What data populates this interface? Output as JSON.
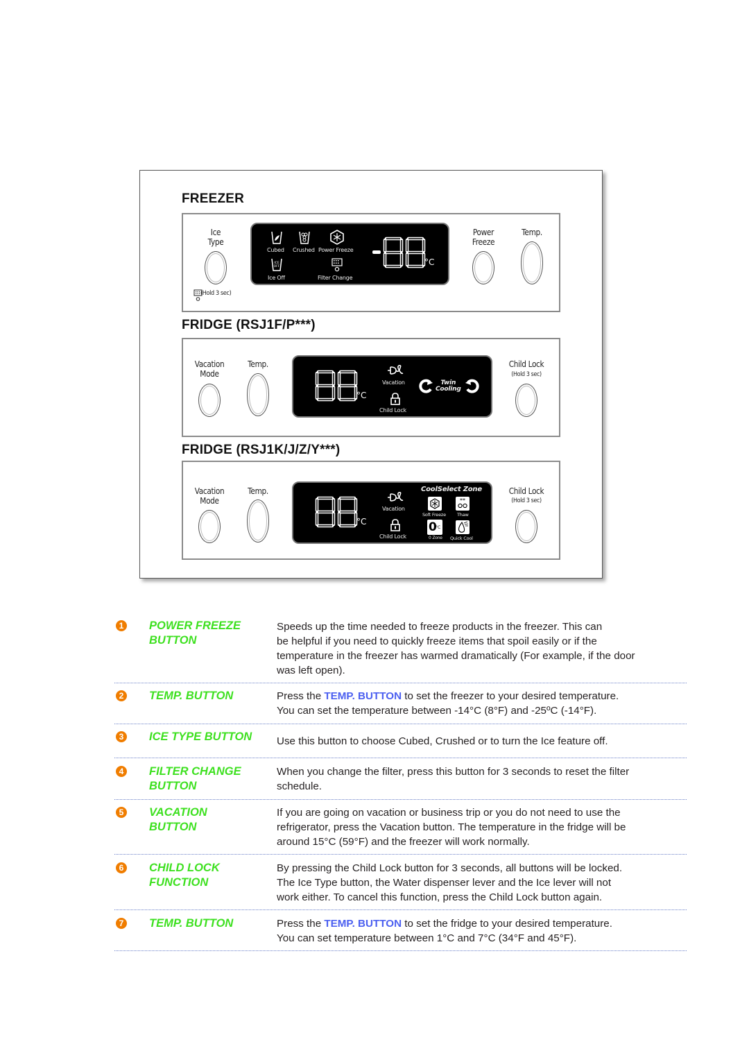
{
  "freezer": {
    "title": "FREEZER",
    "ice_type_label": [
      "Ice",
      "Type"
    ],
    "hold_note": "(Hold 3 sec)",
    "power_freeze_label": [
      "Power",
      "Freeze"
    ],
    "temp_label": "Temp.",
    "lcd": {
      "icons": [
        "Cubed",
        "Crushed",
        "Power Freeze",
        "Ice Off",
        "Filter Change"
      ],
      "ice_off_glyph": [
        "ICE",
        "OFF"
      ],
      "display": "-88",
      "unit": "°C"
    }
  },
  "fridge_f": {
    "title": "FRIDGE (RSJ1F/P***)",
    "vacation_label": [
      "Vacation",
      "Mode"
    ],
    "temp_label": "Temp.",
    "child_lock_label": "Child Lock",
    "child_lock_note": "(Hold 3 sec)",
    "lcd": {
      "display": "88",
      "unit": "°C",
      "vacation": "Vacation",
      "child_lock": "Child Lock",
      "twin_cooling": [
        "Twin",
        "Cooling"
      ]
    }
  },
  "fridge_k": {
    "title": "FRIDGE (RSJ1K/J/Z/Y***)",
    "vacation_label": [
      "Vacation",
      "Mode"
    ],
    "temp_label": "Temp.",
    "child_lock_label": "Child Lock",
    "child_lock_note": "(Hold 3 sec)",
    "lcd": {
      "display": "88",
      "unit": "°C",
      "vacation": "Vacation",
      "child_lock": "Child Lock",
      "coolselect_title": "CoolSelect Zone",
      "soft_freeze": "Soft Freeze",
      "thaw": "Thaw",
      "zero_zone": "0 Zone",
      "zero_glyph": "0",
      "zero_unit": "°C",
      "quick_cool": "Quick Cool"
    }
  },
  "items": [
    {
      "num": "1",
      "title": [
        "POWER FREEZE",
        "BUTTON"
      ],
      "desc": [
        "Speeds up the time needed to freeze products in the freezer. This can",
        "be helpful if you need to quickly freeze items that spoil easily or if the",
        "temperature in the freezer has warmed dramatically (For example, if the door",
        "was left open)."
      ]
    },
    {
      "num": "2",
      "title": [
        "TEMP. BUTTON"
      ],
      "desc_pre": "Press the ",
      "desc_hl": "TEMP. BUTTON",
      "desc_post": " to set the freezer to your desired temperature.",
      "desc2": "You can set the temperature between -14°C (8°F) and -25ºC (-14°F)."
    },
    {
      "num": "3",
      "title": [
        "ICE TYPE BUTTON"
      ],
      "desc": [
        "Use this button to choose Cubed, Crushed or to turn the Ice feature off."
      ]
    },
    {
      "num": "4",
      "title": [
        "FILTER CHANGE",
        "BUTTON"
      ],
      "desc": [
        "When you change the filter, press this button for 3 seconds to reset the filter",
        "schedule."
      ]
    },
    {
      "num": "5",
      "title": [
        "VACATION",
        "BUTTON"
      ],
      "desc": [
        "If you are going on vacation or business trip or you do not need to use the",
        "refrigerator, press the Vacation button. The temperature in the fridge will be",
        "around 15°C (59°F) and the freezer will work normally."
      ]
    },
    {
      "num": "6",
      "title": [
        "CHILD LOCK",
        "FUNCTION"
      ],
      "desc": [
        "By pressing the Child Lock button for 3 seconds, all buttons will be locked.",
        "The Ice Type button, the Water dispenser lever and the Ice lever will not",
        "work either. To cancel this function, press the Child Lock button again."
      ]
    },
    {
      "num": "7",
      "title": [
        "TEMP. BUTTON"
      ],
      "desc_pre": "Press the ",
      "desc_hl": "TEMP. BUTTON",
      "desc_post": " to set the fridge to your desired temperature.",
      "desc2": "You can set temperature between 1°C and 7°C (34°F and 45°F)."
    }
  ],
  "colors": {
    "badge": "#f07d00",
    "title_green": "#3de01f",
    "highlight_blue": "#4b5ff0",
    "separator": "#6a7fc8"
  }
}
